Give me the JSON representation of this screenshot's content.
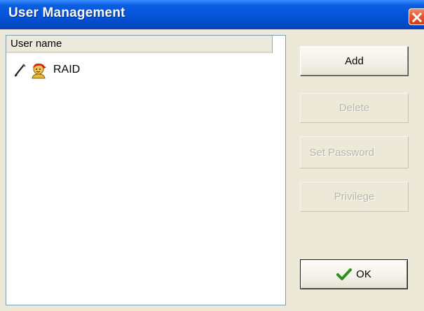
{
  "window": {
    "title": "User Management",
    "close_icon": "close-x-icon"
  },
  "list": {
    "column_header": "User name",
    "rows": [
      {
        "label": "RAID",
        "icons": [
          "edit-pencil-icon",
          "user-icon"
        ]
      }
    ]
  },
  "buttons": {
    "add": "Add",
    "delete": "Delete",
    "password": "Set Password",
    "privilege": "Privilege",
    "ok": "OK"
  },
  "colors": {
    "titlebar": "#0454d8",
    "dialog_bg": "#ece9d8",
    "close_button": "#e5582f",
    "ok_check": "#2f8f1f"
  }
}
